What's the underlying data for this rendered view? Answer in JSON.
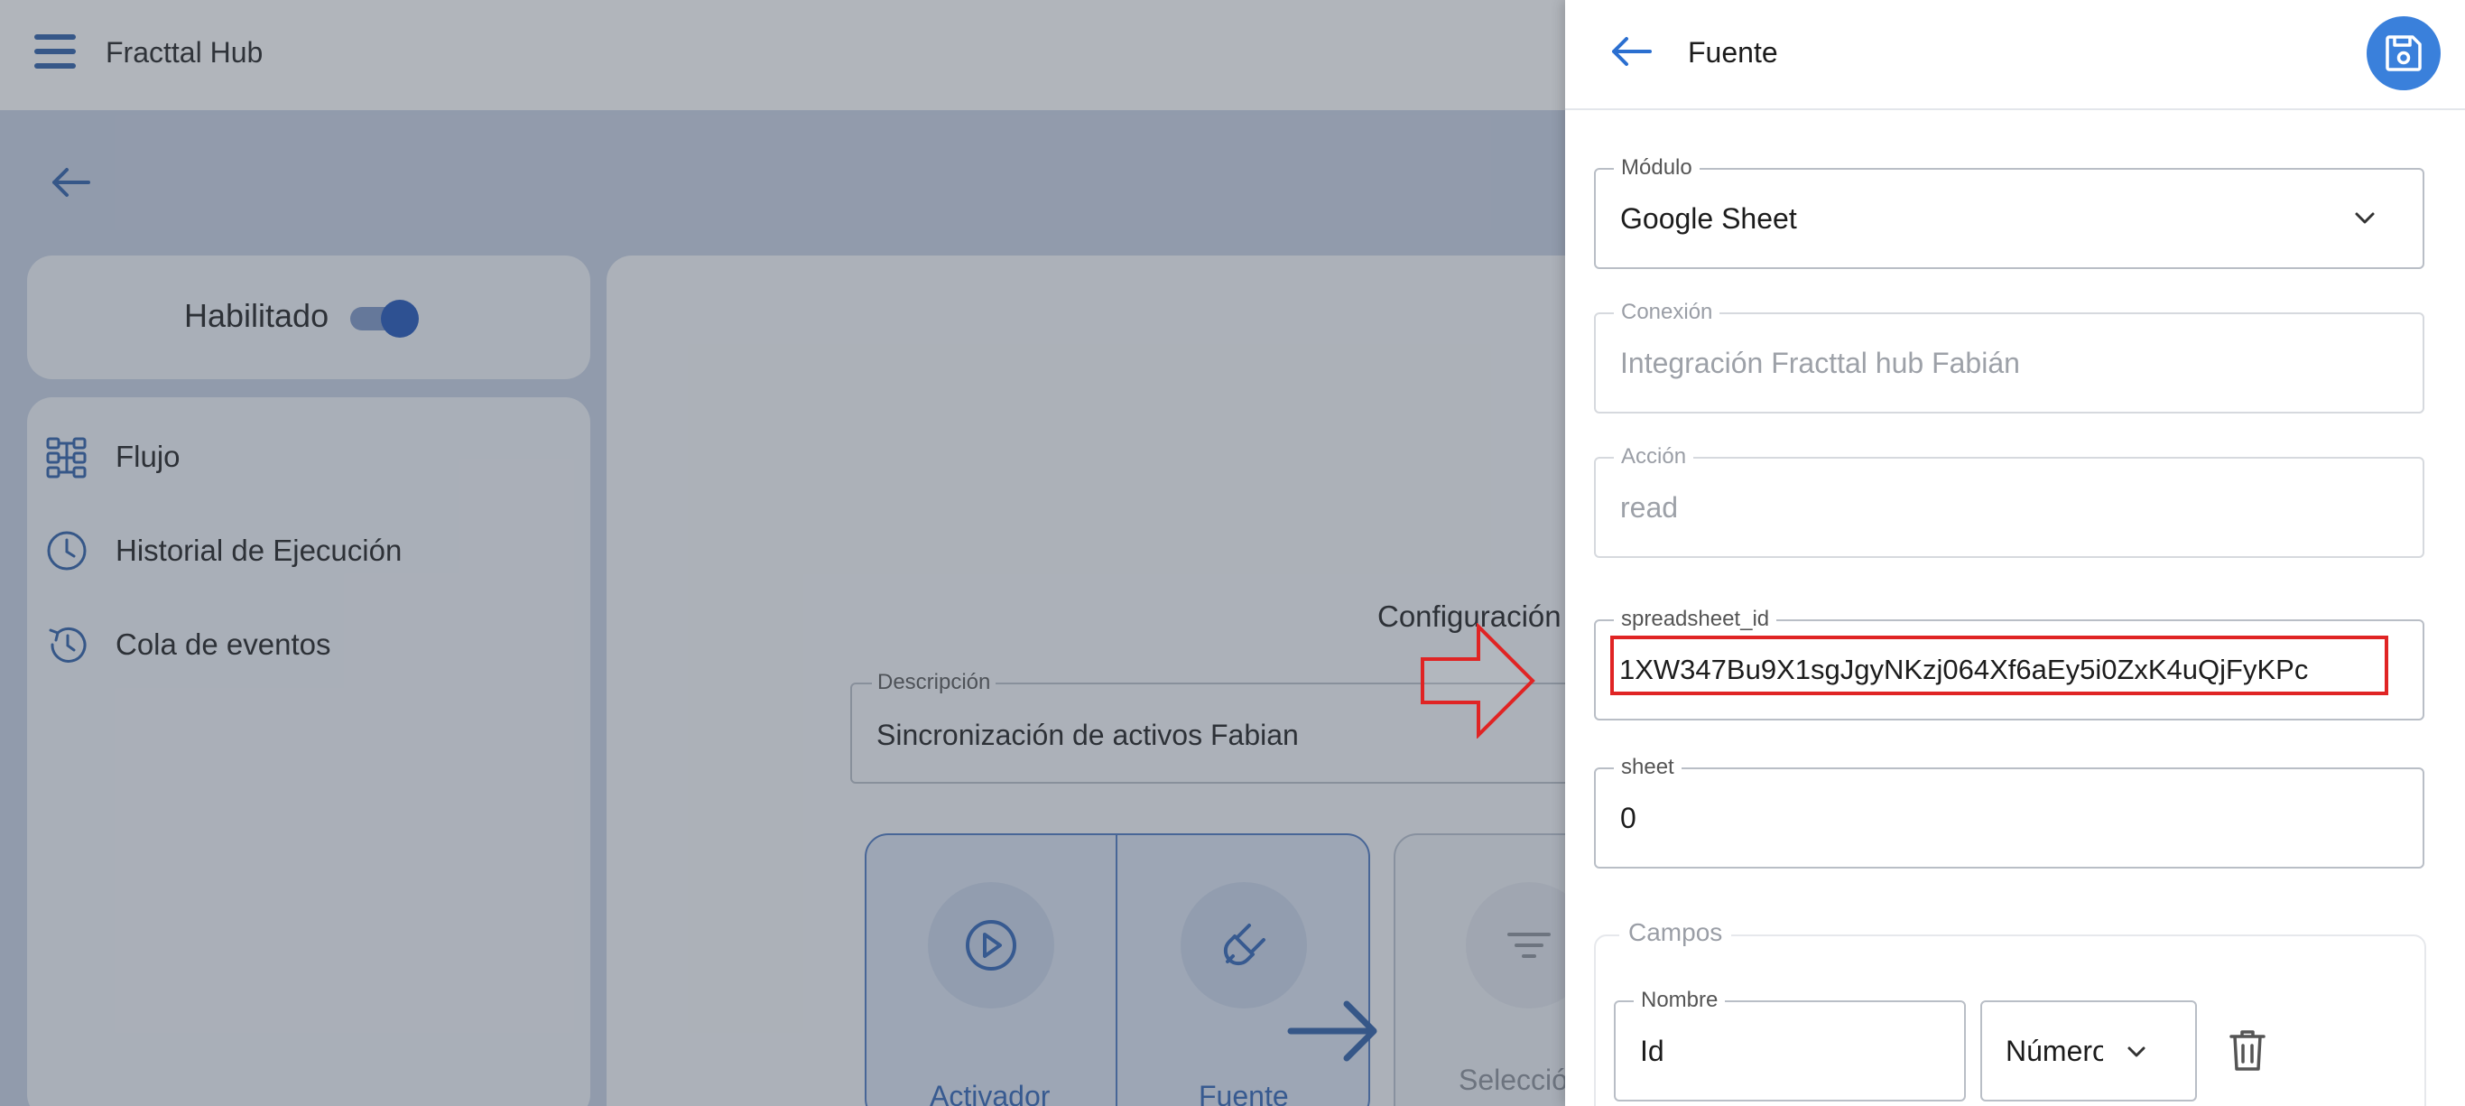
{
  "app": {
    "title": "Fracttal Hub"
  },
  "sidebar": {
    "enabled_label": "Habilitado",
    "enabled": true,
    "items": [
      {
        "label": "Flujo",
        "icon": "flow-icon"
      },
      {
        "label": "Historial de Ejecución",
        "icon": "clock-icon"
      },
      {
        "label": "Cola de eventos",
        "icon": "history-icon"
      }
    ]
  },
  "main": {
    "config_title": "Configuración",
    "description": {
      "label": "Descripción",
      "value": "Sincronización de activos Fabian"
    },
    "flow_steps": [
      {
        "label": "Activador",
        "icon": "play-icon"
      },
      {
        "label": "Fuente",
        "icon": "plug-icon"
      },
      {
        "label": "Selección",
        "icon": "filter-icon"
      }
    ]
  },
  "panel": {
    "title": "Fuente",
    "save_icon": "save-icon",
    "fields": {
      "module": {
        "label": "Módulo",
        "value": "Google Sheet"
      },
      "connection": {
        "label": "Conexión",
        "value": "Integración Fracttal hub Fabián"
      },
      "action": {
        "label": "Acción",
        "value": "read"
      },
      "spreadsheet_id": {
        "label": "spreadsheet_id",
        "value": "1XW347Bu9X1sgJgyNKzj064Xf6aEy5i0ZxK4uQjFyKPc"
      },
      "sheet": {
        "label": "sheet",
        "value": "0"
      }
    },
    "campos": {
      "label": "Campos",
      "rows": [
        {
          "name_label": "Nombre",
          "name_value": "Id",
          "type_value": "Número"
        }
      ]
    }
  },
  "colors": {
    "accent": "#3a80db",
    "highlight": "#e02424"
  }
}
